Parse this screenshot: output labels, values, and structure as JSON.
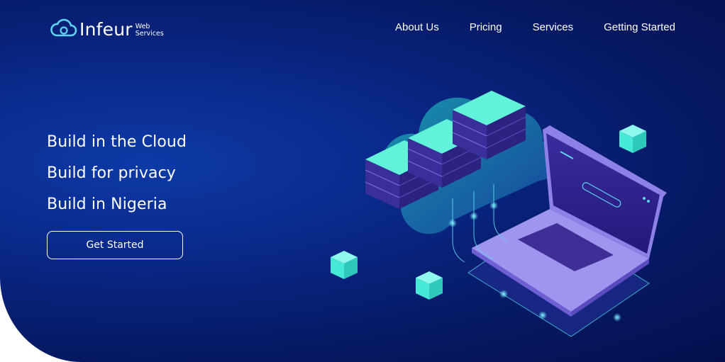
{
  "brand": {
    "name": "Infeur",
    "sub_line1": "Web",
    "sub_line2": "Services",
    "accent": "#5fd4f0"
  },
  "nav": {
    "items": [
      {
        "label": "About Us"
      },
      {
        "label": "Pricing"
      },
      {
        "label": "Services"
      },
      {
        "label": "Getting Started"
      }
    ]
  },
  "hero": {
    "headlines": [
      "Build in the Cloud",
      "Build for privacy",
      "Build in Nigeria"
    ],
    "cta_label": "Get Started",
    "colors": {
      "background": "#071c6b",
      "server_top": "#5ff0d8",
      "server_body": "#3b2f9e",
      "laptop": "#b3a9f2",
      "cube": "#46e8d6"
    }
  }
}
